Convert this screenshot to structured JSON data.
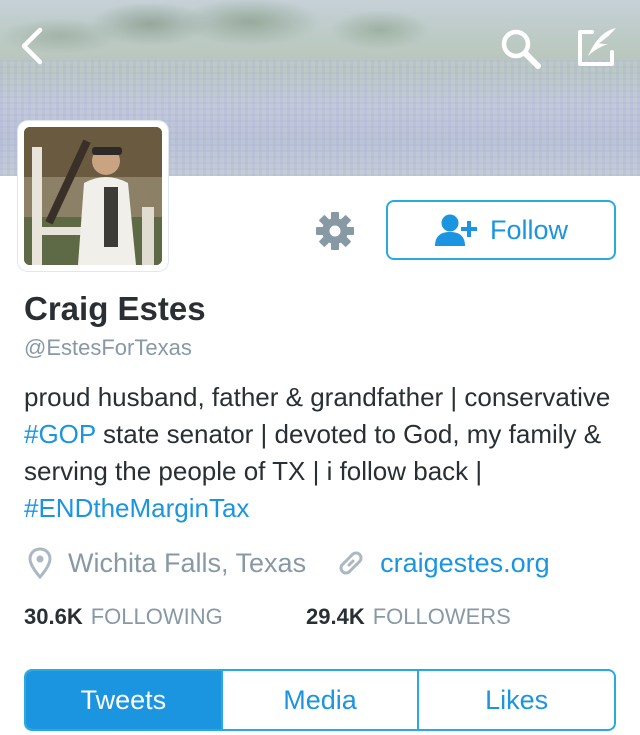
{
  "header": {
    "icons": {
      "back": "chevron-left-icon",
      "search": "search-icon",
      "compose": "compose-icon"
    }
  },
  "profile": {
    "name": "Craig Estes",
    "handle": "@EstesForTexas",
    "bio": {
      "part1": "proud husband, father & grandfather | conservative ",
      "hashtag1": "#GOP",
      "part2": " state senator | devoted to God, my family & serving the people of TX | i follow back | ",
      "hashtag2": "#ENDtheMarginTax"
    },
    "location": "Wichita Falls, Texas",
    "website": "craigestes.org"
  },
  "actions": {
    "follow_label": "Follow",
    "settings_icon": "gear-icon",
    "follow_icon": "add-user-icon"
  },
  "stats": {
    "following_count": "30.6K",
    "following_label": "FOLLOWING",
    "followers_count": "29.4K",
    "followers_label": "FOLLOWERS"
  },
  "tabs": [
    {
      "label": "Tweets",
      "active": true
    },
    {
      "label": "Media",
      "active": false
    },
    {
      "label": "Likes",
      "active": false
    }
  ],
  "colors": {
    "accent": "#1b95e0",
    "border_accent": "#2aa9e0",
    "text": "#292f33",
    "muted": "#8899a6"
  }
}
